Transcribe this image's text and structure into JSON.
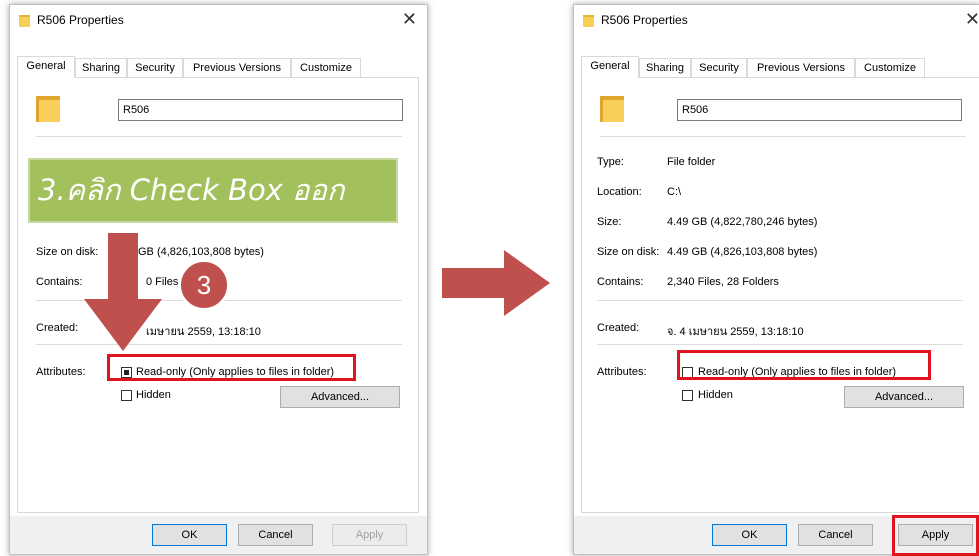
{
  "left_dialog": {
    "title": "R506 Properties",
    "tabs": [
      "General",
      "Sharing",
      "Security",
      "Previous Versions",
      "Customize"
    ],
    "folder_name": "R506",
    "rows": {
      "size_on_disk_label": "Size on disk:",
      "size_on_disk_value": "GB (4,826,103,808 bytes)",
      "contains_label": "Contains:",
      "contains_value": "0 Files",
      "created_label": "Created:",
      "created_value": "เมษายน 2559, 13:18:10",
      "attributes_label": "Attributes:"
    },
    "readonly_label": "Read-only (Only applies to files in folder)",
    "hidden_label": "Hidden",
    "advanced_label": "Advanced...",
    "ok_label": "OK",
    "cancel_label": "Cancel",
    "apply_label": "Apply"
  },
  "right_dialog": {
    "title": "R506 Properties",
    "tabs": [
      "General",
      "Sharing",
      "Security",
      "Previous Versions",
      "Customize"
    ],
    "folder_name": "R506",
    "rows": {
      "type_label": "Type:",
      "type_value": "File folder",
      "location_label": "Location:",
      "location_value": "C:\\",
      "size_label": "Size:",
      "size_value": "4.49 GB (4,822,780,246 bytes)",
      "size_on_disk_label": "Size on disk:",
      "size_on_disk_value": "4.49 GB (4,826,103,808 bytes)",
      "contains_label": "Contains:",
      "contains_value": "2,340 Files, 28 Folders",
      "created_label": "Created:",
      "created_value": "จ. 4 เมษายน 2559, 13:18:10",
      "attributes_label": "Attributes:"
    },
    "readonly_label": "Read-only (Only applies to files in folder)",
    "hidden_label": "Hidden",
    "advanced_label": "Advanced...",
    "ok_label": "OK",
    "cancel_label": "Cancel",
    "apply_label": "Apply"
  },
  "annotation": {
    "banner_text": "3.คลิก Check Box ออก",
    "step_number": "3",
    "highlight_color": "#e0141e",
    "banner_color": "#a2c05b",
    "arrow_color": "#c0504d"
  }
}
